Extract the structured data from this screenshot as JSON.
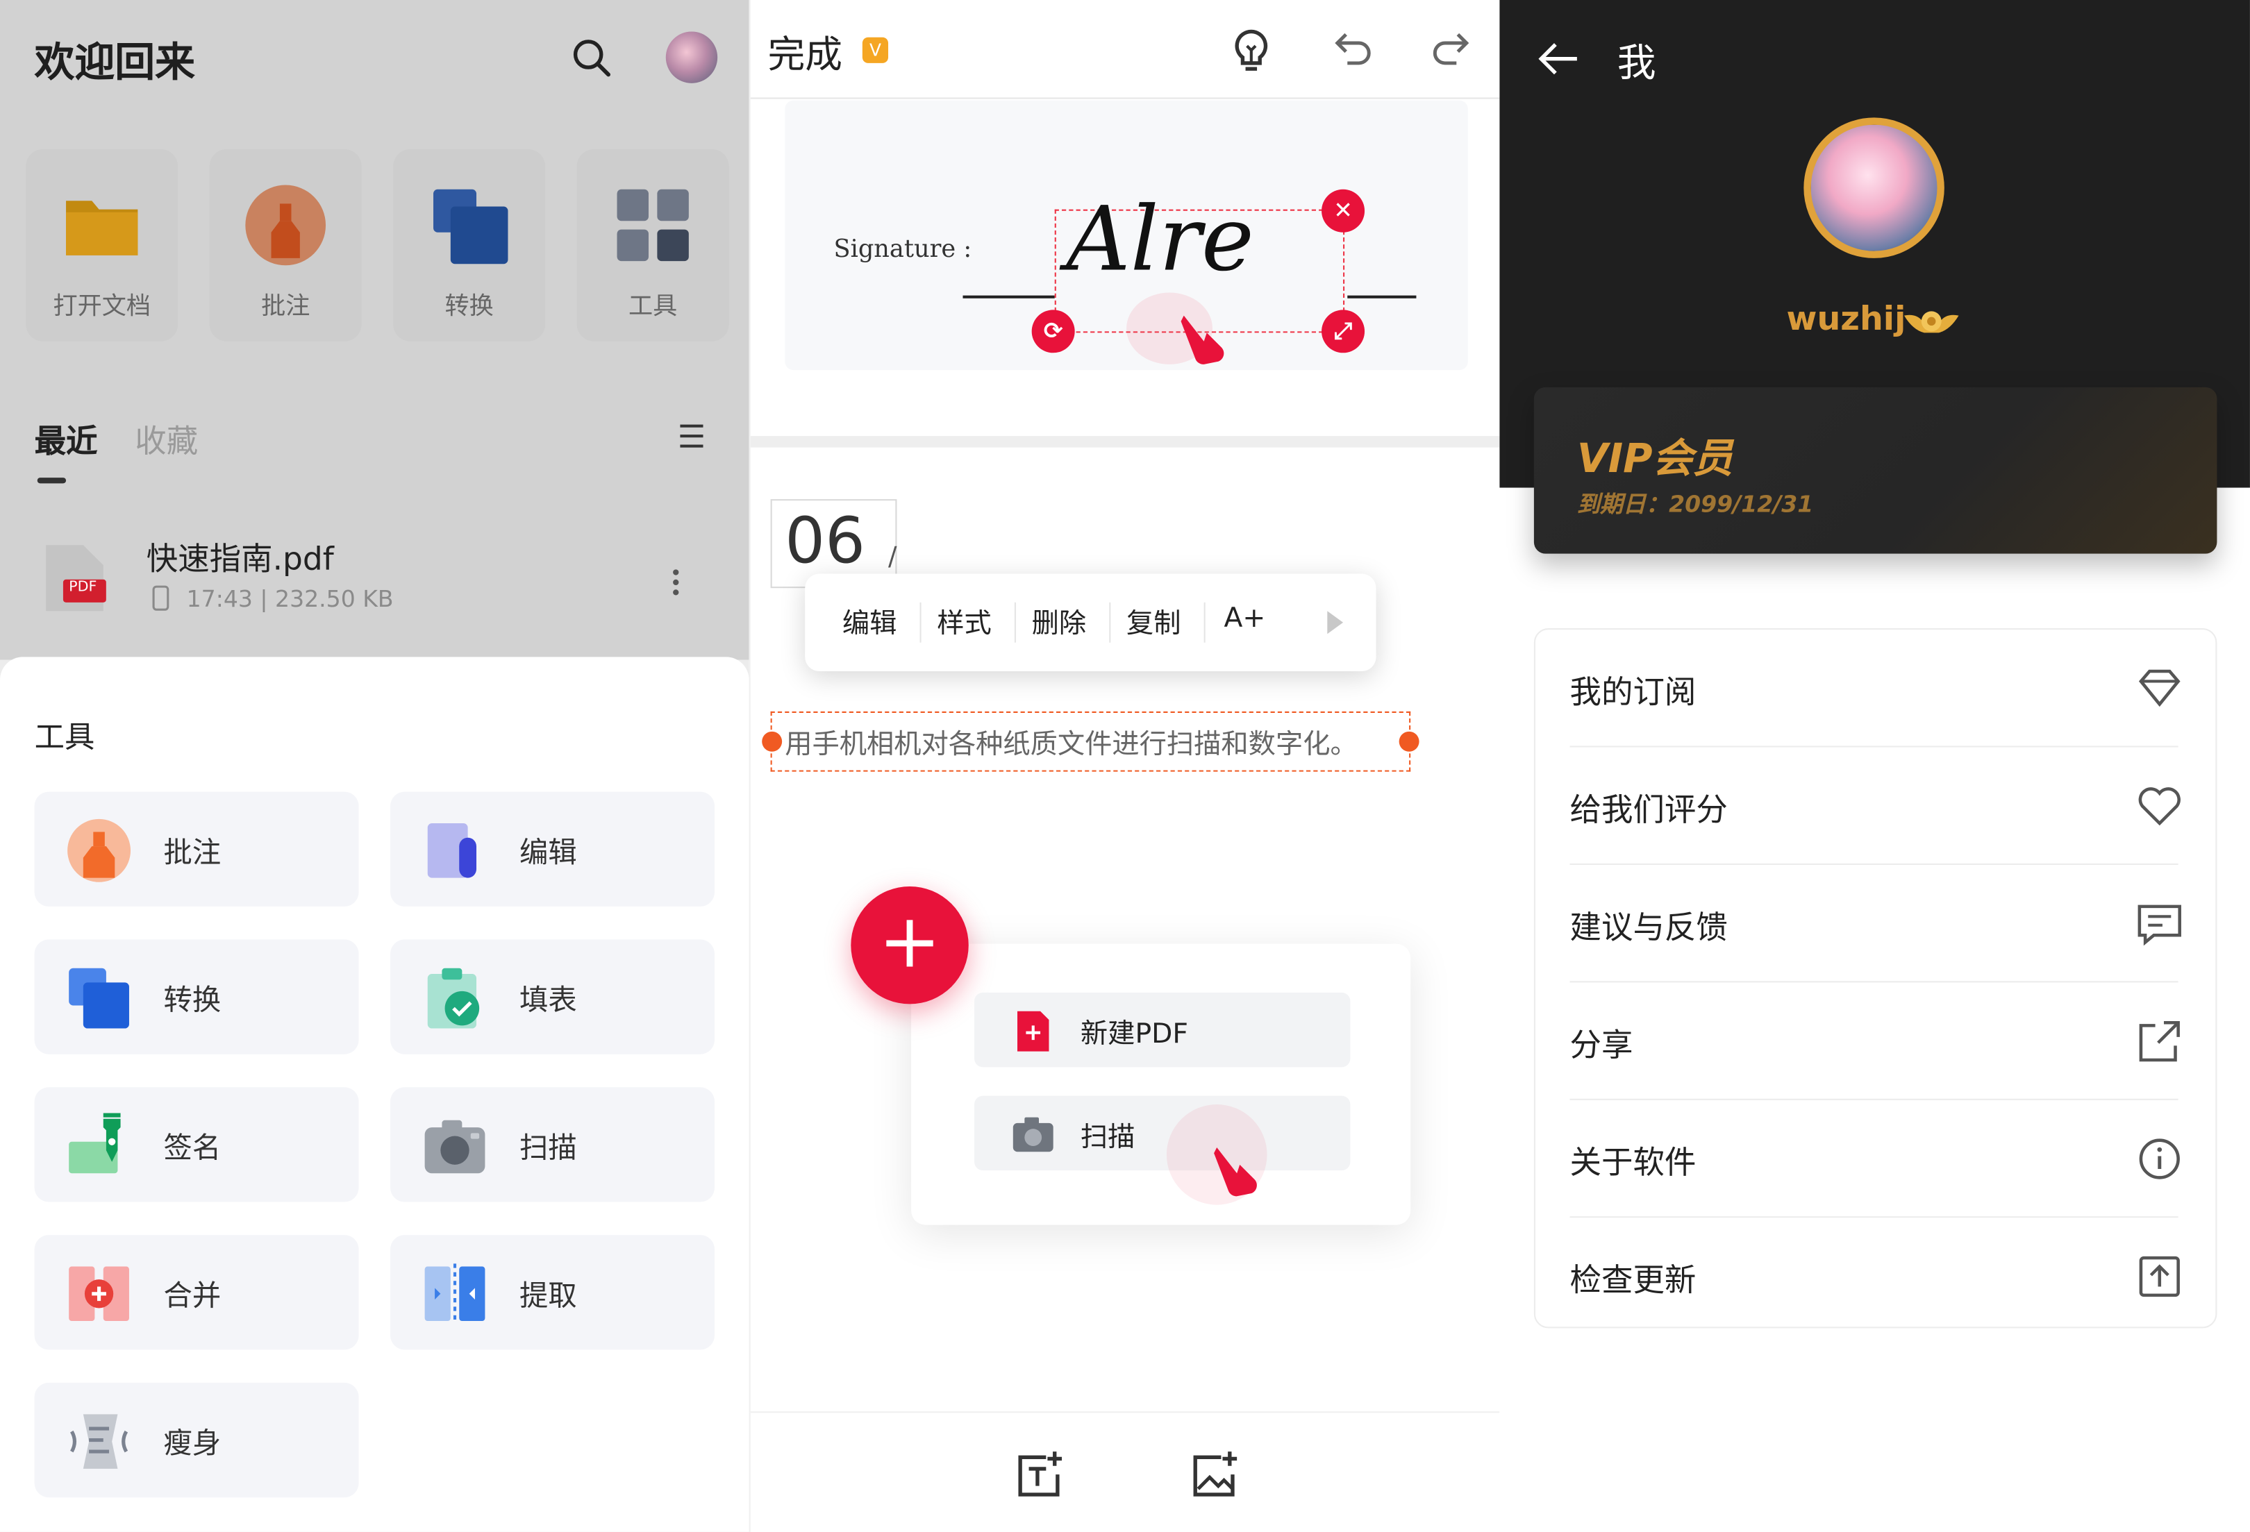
{
  "panel1": {
    "title": "欢迎回来",
    "quick_actions": [
      {
        "label": "打开文档",
        "icon": "folder-icon"
      },
      {
        "label": "批注",
        "icon": "annotate-icon"
      },
      {
        "label": "转换",
        "icon": "convert-icon"
      },
      {
        "label": "工具",
        "icon": "tools-grid-icon"
      }
    ],
    "tabs": {
      "recent": "最近",
      "favorites": "收藏"
    },
    "file": {
      "name": "快速指南.pdf",
      "meta": "17:43 | 232.50 KB",
      "badge": "PDF"
    },
    "sheet": {
      "title": "工具",
      "tools": [
        {
          "label": "批注",
          "icon": "annotate-icon"
        },
        {
          "label": "编辑",
          "icon": "edit-icon"
        },
        {
          "label": "转换",
          "icon": "convert-icon"
        },
        {
          "label": "填表",
          "icon": "fill-form-icon"
        },
        {
          "label": "签名",
          "icon": "signature-icon"
        },
        {
          "label": "扫描",
          "icon": "camera-icon"
        },
        {
          "label": "合并",
          "icon": "merge-icon"
        },
        {
          "label": "提取",
          "icon": "extract-icon"
        },
        {
          "label": "瘦身",
          "icon": "compress-icon"
        }
      ]
    }
  },
  "panel2": {
    "done": "完成",
    "vip_badge": "V",
    "signature_label": "Signature :",
    "signature_text": "Alre",
    "page_number": "06",
    "page_slash": "/",
    "context_menu": [
      "编辑",
      "样式",
      "删除",
      "复制",
      "A+"
    ],
    "selected_text": "用手机相机对各种纸质文件进行扫描和数字化。",
    "fab_plus": "+",
    "fab_options": [
      {
        "label": "新建PDF",
        "icon": "new-pdf-icon"
      },
      {
        "label": "扫描",
        "icon": "camera-icon"
      }
    ]
  },
  "panel3": {
    "title": "我",
    "username": "wuzhij",
    "vip_title": "VIP会员",
    "vip_expiry": "到期日：2099/12/31",
    "menu": [
      {
        "label": "我的订阅",
        "icon": "diamond-icon"
      },
      {
        "label": "给我们评分",
        "icon": "heart-icon"
      },
      {
        "label": "建议与反馈",
        "icon": "message-icon"
      },
      {
        "label": "分享",
        "icon": "share-icon"
      },
      {
        "label": "关于软件",
        "icon": "info-icon"
      },
      {
        "label": "检查更新",
        "icon": "update-icon"
      }
    ]
  },
  "colors": {
    "accent_red": "#e8123a",
    "gold": "#d99a3a",
    "selection_orange": "#f05a22"
  }
}
